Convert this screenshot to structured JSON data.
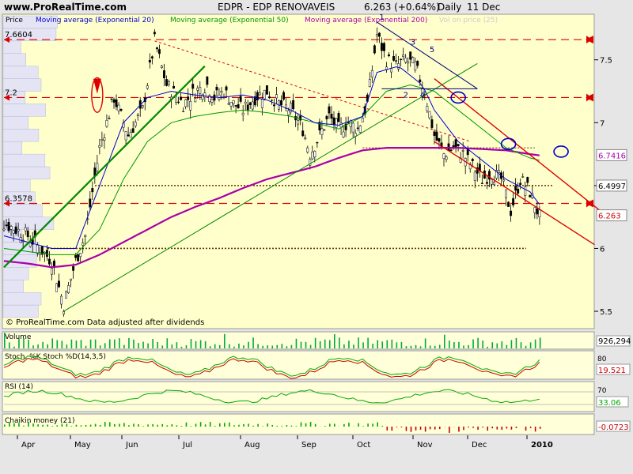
{
  "header": {
    "site": "www.ProRealTime.com",
    "title": "EDPR - EDP RENOVAVEIS",
    "quote": "6.263 (+0.64%)",
    "period": "Daily",
    "date": "11 Dec"
  },
  "legend": {
    "price": "Price",
    "ema20": "Moving average (Exponential 20)",
    "ema50": "Moving average (Exponential 50)",
    "ema200": "Moving average (Exponential 200)",
    "vol": "Vol on price (25)"
  },
  "copyright": "© ProRealTime.com  Data adjusted after dividends",
  "colors": {
    "bg": "#ffffcc",
    "ema20": "#0000cc",
    "ema50": "#009900",
    "ema200": "#aa00aa",
    "red": "#dd0000",
    "trend_green": "#008800",
    "panel": "#ffffd9"
  },
  "chart_data": {
    "type": "candlestick",
    "y_range": [
      5.45,
      7.85
    ],
    "y_ticks": [
      5.5,
      6,
      6.5,
      7,
      7.5
    ],
    "y_tick_labels": [
      "5.5",
      "6",
      "6.5",
      "7",
      "7.5"
    ],
    "x_months": [
      "Apr",
      "May",
      "Jun",
      "Jul",
      "Aug",
      "Sep",
      "Oct",
      "Nov",
      "Dec",
      "2010"
    ],
    "price_path": [
      [
        0,
        6.2
      ],
      [
        10,
        6.1
      ],
      [
        20,
        5.9
      ],
      [
        25,
        5.55
      ],
      [
        30,
        5.9
      ],
      [
        34,
        6.1
      ],
      [
        40,
        6.8
      ],
      [
        46,
        7.2
      ],
      [
        52,
        6.9
      ],
      [
        58,
        7.1
      ],
      [
        63,
        7.65
      ],
      [
        68,
        7.3
      ],
      [
        75,
        7.15
      ],
      [
        80,
        7.25
      ],
      [
        85,
        7.3
      ],
      [
        88,
        7.2
      ],
      [
        92,
        7.25
      ],
      [
        96,
        7.15
      ],
      [
        100,
        7.1
      ],
      [
        105,
        7.2
      ],
      [
        110,
        7.25
      ],
      [
        115,
        7.15
      ],
      [
        120,
        7.1
      ],
      [
        125,
        6.95
      ],
      [
        128,
        6.75
      ],
      [
        132,
        6.9
      ],
      [
        136,
        7.05
      ],
      [
        140,
        6.95
      ],
      [
        144,
        7.0
      ],
      [
        148,
        6.95
      ],
      [
        152,
        7.15
      ],
      [
        156,
        7.7
      ],
      [
        160,
        7.5
      ],
      [
        164,
        7.45
      ],
      [
        168,
        7.5
      ],
      [
        172,
        7.45
      ],
      [
        176,
        7.25
      ],
      [
        180,
        6.9
      ],
      [
        184,
        6.75
      ],
      [
        188,
        6.8
      ],
      [
        192,
        6.75
      ],
      [
        196,
        6.65
      ],
      [
        200,
        6.55
      ],
      [
        204,
        6.6
      ],
      [
        208,
        6.55
      ],
      [
        212,
        6.3
      ],
      [
        216,
        6.55
      ],
      [
        220,
        6.45
      ],
      [
        224,
        6.25
      ]
    ],
    "ema20_path": [
      [
        0,
        6.1
      ],
      [
        20,
        6.0
      ],
      [
        30,
        6.0
      ],
      [
        40,
        6.5
      ],
      [
        50,
        7.0
      ],
      [
        60,
        7.2
      ],
      [
        70,
        7.25
      ],
      [
        80,
        7.22
      ],
      [
        90,
        7.2
      ],
      [
        100,
        7.22
      ],
      [
        110,
        7.18
      ],
      [
        120,
        7.1
      ],
      [
        130,
        7.0
      ],
      [
        140,
        6.98
      ],
      [
        150,
        7.05
      ],
      [
        156,
        7.4
      ],
      [
        165,
        7.45
      ],
      [
        175,
        7.3
      ],
      [
        180,
        7.1
      ],
      [
        190,
        6.85
      ],
      [
        200,
        6.7
      ],
      [
        210,
        6.55
      ],
      [
        220,
        6.45
      ],
      [
        224,
        6.35
      ]
    ],
    "ema50_path": [
      [
        0,
        6.0
      ],
      [
        20,
        5.95
      ],
      [
        30,
        5.95
      ],
      [
        40,
        6.15
      ],
      [
        50,
        6.55
      ],
      [
        60,
        6.85
      ],
      [
        70,
        7.0
      ],
      [
        80,
        7.05
      ],
      [
        90,
        7.08
      ],
      [
        100,
        7.1
      ],
      [
        110,
        7.08
      ],
      [
        120,
        7.05
      ],
      [
        130,
        7.0
      ],
      [
        140,
        6.95
      ],
      [
        150,
        7.05
      ],
      [
        160,
        7.25
      ],
      [
        170,
        7.3
      ],
      [
        180,
        7.25
      ],
      [
        190,
        7.1
      ],
      [
        200,
        6.95
      ],
      [
        210,
        6.8
      ],
      [
        220,
        6.72
      ],
      [
        224,
        6.7
      ]
    ],
    "ema200_path": [
      [
        0,
        5.9
      ],
      [
        10,
        5.88
      ],
      [
        20,
        5.85
      ],
      [
        30,
        5.87
      ],
      [
        40,
        5.95
      ],
      [
        50,
        6.05
      ],
      [
        60,
        6.15
      ],
      [
        70,
        6.25
      ],
      [
        80,
        6.33
      ],
      [
        90,
        6.4
      ],
      [
        100,
        6.48
      ],
      [
        110,
        6.55
      ],
      [
        120,
        6.6
      ],
      [
        130,
        6.65
      ],
      [
        140,
        6.72
      ],
      [
        150,
        6.78
      ],
      [
        160,
        6.8
      ],
      [
        170,
        6.8
      ],
      [
        180,
        6.8
      ],
      [
        190,
        6.8
      ],
      [
        200,
        6.79
      ],
      [
        210,
        6.78
      ],
      [
        220,
        6.75
      ],
      [
        224,
        6.74
      ]
    ],
    "h_levels": [
      {
        "value": 7.6604,
        "label": "7.6604"
      },
      {
        "value": 7.2,
        "label": "7.2"
      },
      {
        "value": 6.3578,
        "label": "6.3578"
      }
    ],
    "dotted_levels": [
      {
        "value": 6.5,
        "label": "6.4997"
      },
      {
        "value": 6.0
      }
    ],
    "right_labels": [
      {
        "value": 6.7416,
        "label": "6.7416"
      },
      {
        "value": 6.4997,
        "label": "6.4997"
      },
      {
        "value": 6.263,
        "label": "6.263"
      }
    ],
    "wave_labels": [
      "1",
      "2",
      "3",
      "4",
      "5"
    ]
  },
  "panels": {
    "volume": {
      "label": "Volume",
      "value": "926,294"
    },
    "stoch": {
      "label": "Stoch. %K Stoch %D(14,3,5)",
      "value": "19.521",
      "top": "80"
    },
    "rsi": {
      "label": "RSI (14)",
      "value": "33.06",
      "top": "70"
    },
    "chaikin": {
      "label": "Chaikin money (21)",
      "value": "-0.0723"
    }
  }
}
